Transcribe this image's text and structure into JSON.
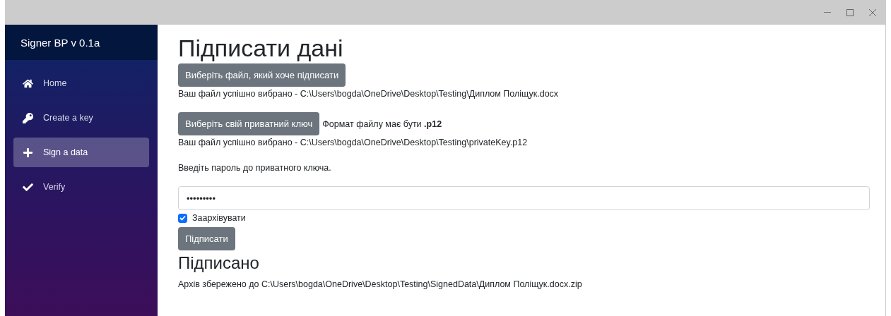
{
  "app": {
    "title": "Signer BP v 0.1a"
  },
  "sidebar": {
    "items": [
      {
        "label": "Home",
        "kind": "home",
        "selected": false
      },
      {
        "label": "Create a key",
        "kind": "key",
        "selected": false
      },
      {
        "label": "Sign a data",
        "kind": "plus",
        "selected": true
      },
      {
        "label": "Verify",
        "kind": "check",
        "selected": false
      }
    ]
  },
  "page": {
    "heading": "Підписати дані",
    "file_button": "Виберіть файл, який хоче підписати",
    "file_status": "Ваш файл успішно вибрано - C:\\Users\\bogda\\OneDrive\\Desktop\\Testing\\Диплом Поліщук.docx",
    "key_button": "Виберіть свій приватний ключ",
    "key_hint": "Формат файлу має бути **.p12**",
    "key_status": "Ваш файл успішно вибрано - C:\\Users\\bogda\\OneDrive\\Desktop\\Testing\\privateKey.p12",
    "password_label": "Введіть пароль до приватного ключа.",
    "password_value": "•••••••••",
    "archive": {
      "label": "Заархівувати",
      "checked": true
    },
    "sign_button": "Підписати",
    "result_heading": "Підписано",
    "result_text": "Архів збережено до C:\\Users\\bogda\\OneDrive\\Desktop\\Testing\\SignedData\\Диплом Поліщук.docx.zip"
  }
}
